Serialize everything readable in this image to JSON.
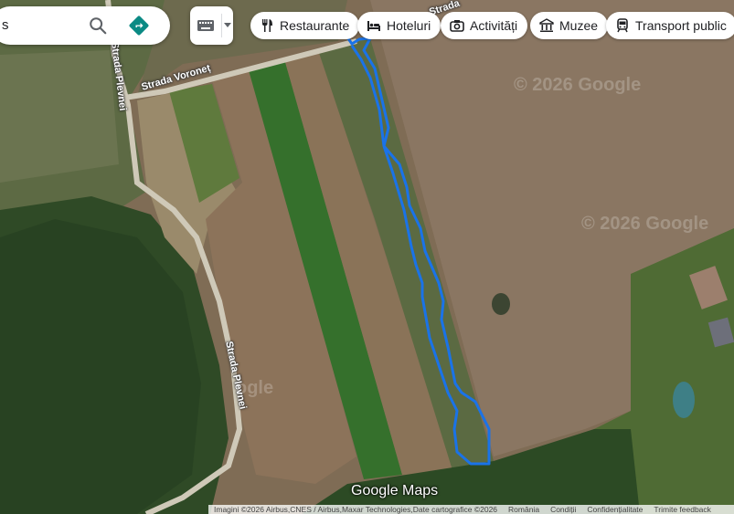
{
  "search": {
    "text": "s"
  },
  "chips": [
    {
      "label": "Restaurante",
      "icon": "fork-knife-icon"
    },
    {
      "label": "Hoteluri",
      "icon": "bed-icon"
    },
    {
      "label": "Activități",
      "icon": "camera-icon"
    },
    {
      "label": "Muzee",
      "icon": "museum-icon"
    },
    {
      "label": "Transport public",
      "icon": "train-icon"
    }
  ],
  "map": {
    "layer": "satellite",
    "roads": [
      {
        "label": "Strada Voroneț"
      },
      {
        "label": "Strada Plevnei"
      },
      {
        "label": "Strada Plevnei"
      },
      {
        "label": "Strada"
      }
    ],
    "watermarks": [
      "© 2026 Google",
      "© 2026 Google",
      "ogle"
    ],
    "route_color": "#1a73e8",
    "logo": "Google Maps"
  },
  "footer": {
    "attribution": "Imagini ©2026 Airbus,CNES / Airbus,Maxar Technologies,Date cartografice ©2026",
    "links": [
      "România",
      "Condiții",
      "Confidențialitate",
      "Trimite feedback"
    ]
  }
}
